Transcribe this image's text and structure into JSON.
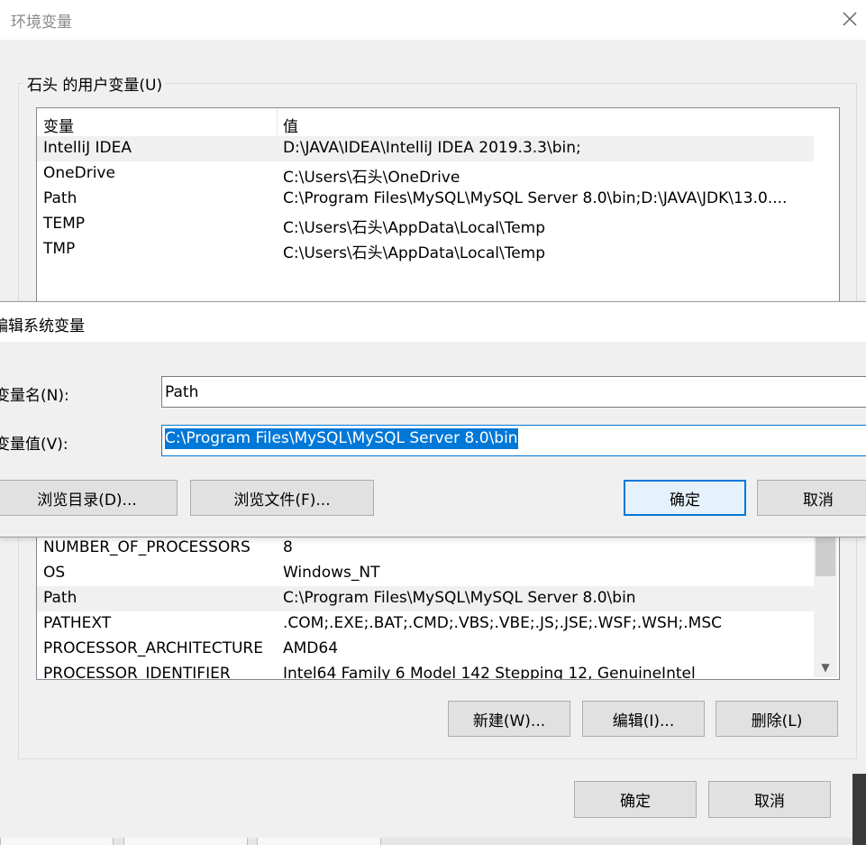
{
  "env_dialog": {
    "title": "环境变量",
    "close_icon": "close-icon",
    "user_group": {
      "label": "石头 的用户变量(U)",
      "columns": [
        "变量",
        "值"
      ],
      "rows": [
        {
          "name": "IntelliJ IDEA",
          "value": "D:\\JAVA\\IDEA\\IntelliJ IDEA 2019.3.3\\bin;",
          "selected": true
        },
        {
          "name": "OneDrive",
          "value": "C:\\Users\\石头\\OneDrive"
        },
        {
          "name": "Path",
          "value": "C:\\Program Files\\MySQL\\MySQL Server 8.0\\bin;D:\\JAVA\\JDK\\13.0...."
        },
        {
          "name": "TEMP",
          "value": "C:\\Users\\石头\\AppData\\Local\\Temp"
        },
        {
          "name": "TMP",
          "value": "C:\\Users\\石头\\AppData\\Local\\Temp"
        }
      ]
    },
    "system_group": {
      "rows": [
        {
          "name": "NUMBER_OF_PROCESSORS",
          "value": "8"
        },
        {
          "name": "OS",
          "value": "Windows_NT"
        },
        {
          "name": "Path",
          "value": "C:\\Program Files\\MySQL\\MySQL Server 8.0\\bin",
          "selected": true
        },
        {
          "name": "PATHEXT",
          "value": ".COM;.EXE;.BAT;.CMD;.VBS;.VBE;.JS;.JSE;.WSF;.WSH;.MSC"
        },
        {
          "name": "PROCESSOR_ARCHITECTURE",
          "value": "AMD64"
        },
        {
          "name": "PROCESSOR_IDENTIFIER",
          "value": "Intel64 Family 6 Model 142 Stepping 12, GenuineIntel"
        }
      ],
      "buttons": {
        "new": "新建(W)...",
        "edit": "编辑(I)...",
        "delete": "删除(L)"
      }
    },
    "ok": "确定",
    "cancel": "取消"
  },
  "edit_dialog": {
    "title": "编辑系统变量",
    "name_label": "变量名(N):",
    "name_value": "Path",
    "value_label": "变量值(V):",
    "value_value": "C:\\Program Files\\MySQL\\MySQL Server 8.0\\bin",
    "browse_dir": "浏览目录(D)...",
    "browse_file": "浏览文件(F)...",
    "ok": "确定",
    "cancel": "取消"
  }
}
